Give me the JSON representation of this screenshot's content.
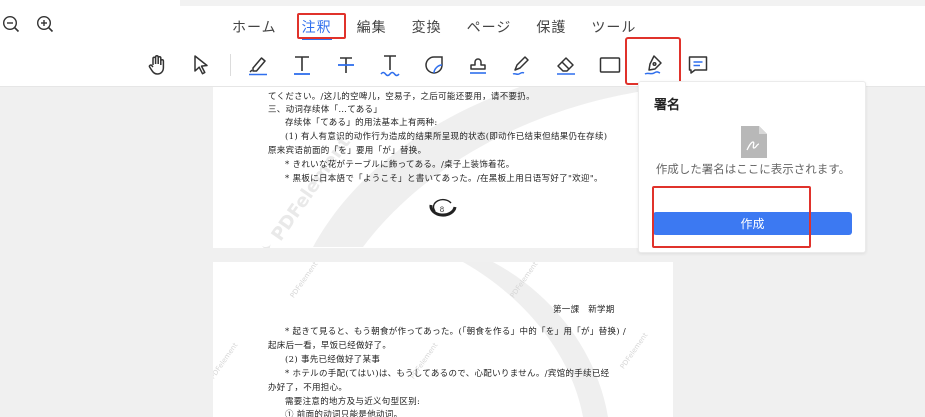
{
  "zoom": {
    "zoom_out_icon": "zoom-out-icon",
    "zoom_in_icon": "zoom-in-icon"
  },
  "tabs": [
    {
      "label": "ホーム"
    },
    {
      "label": "注釈"
    },
    {
      "label": "編集"
    },
    {
      "label": "変換"
    },
    {
      "label": "ページ"
    },
    {
      "label": "保護"
    },
    {
      "label": "ツール"
    }
  ],
  "active_tab": "注釈",
  "tools": [
    "hand-icon",
    "select-arrow-icon",
    "highlight-icon",
    "underline-text-icon",
    "strikethrough-text-icon",
    "squiggly-text-icon",
    "sticky-note-icon",
    "stamp-icon",
    "pencil-icon",
    "eraser-icon",
    "rectangle-icon",
    "signature-pen-icon",
    "comment-icon"
  ],
  "colors": {
    "accent": "#2f6fed",
    "highlight_box": "#e0322b",
    "button": "#3c79f2"
  },
  "signature_panel": {
    "title": "署名",
    "empty_text": "作成した署名はここに表示されます。",
    "create_button": "作成"
  },
  "page1": {
    "lines": [
      "てください。/这儿的空啤儿，空易子，之后可能还要用，请不要扔。",
      "三、动词存续体「…てある」",
      "存续体「てある」的用法基本上有两种:",
      "(1) 有人有意识的动作行为造成的结果所呈现的状态(即动作已结束但结果仍在存续)",
      "原来宾语前面的「を」要用「が」替换。",
      "* きれいな花がテーブルに飾ってある。/桌子上装饰着花。",
      "* 黒板に日本語で「ようこそ」と書いてあった。/在黑板上用日语写好了\"欢迎\"。"
    ],
    "page_number": "8"
  },
  "page2": {
    "header": "第一課　新学期",
    "lines": [
      "* 起きて見ると、もう朝食が作ってあった。(「朝食を作る」中的「を」用「が」替换) /",
      "起床后一看，早饭已经做好了。",
      "(2) 事先已经做好了某事",
      "* ホテルの手配(てはい)は、もうしてあるので、心配いりません。/宾馆的手续已经",
      "办好了，不用担心。",
      "需要注意的地方及与近义句型区别:",
      "① 前面的动词只能是他动词。"
    ]
  },
  "watermark_text": "PDFelement"
}
